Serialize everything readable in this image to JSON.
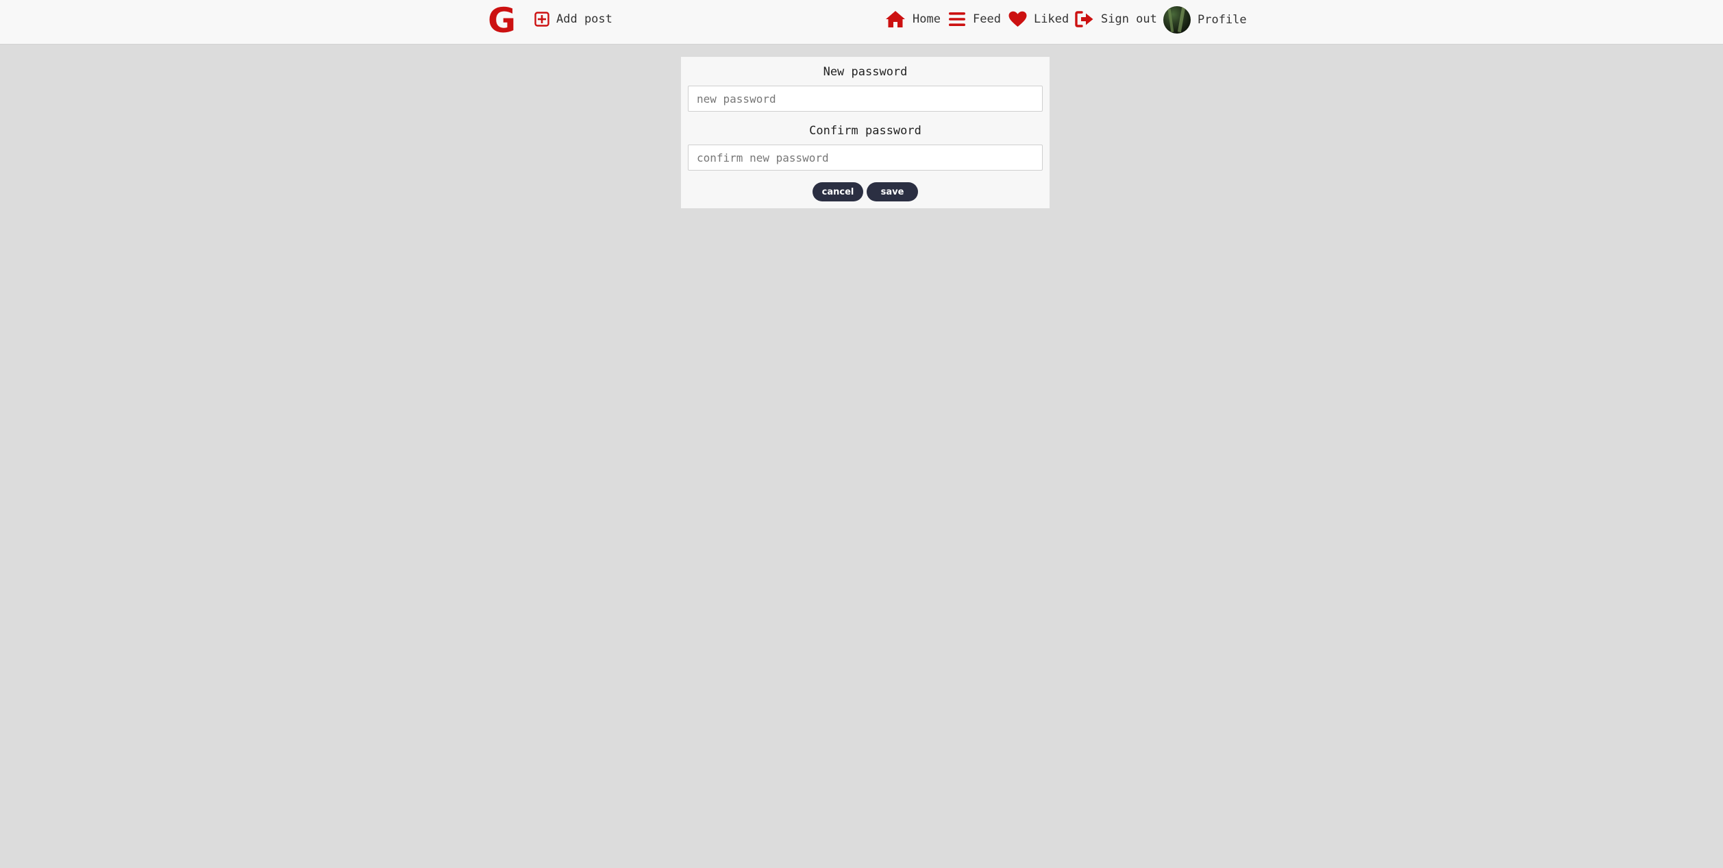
{
  "header": {
    "logo_text": "G",
    "add_post_label": "Add post",
    "nav": {
      "home": "Home",
      "feed": "Feed",
      "liked": "Liked",
      "sign_out": "Sign out",
      "profile": "Profile"
    },
    "icons": {
      "add_post": "plus-square-icon",
      "home": "home-icon",
      "feed": "menu-bars-icon",
      "liked": "heart-icon",
      "sign_out": "sign-out-icon"
    }
  },
  "form": {
    "new_password_label": "New password",
    "new_password_placeholder": "new password",
    "new_password_value": "",
    "confirm_password_label": "Confirm password",
    "confirm_password_placeholder": "confirm new password",
    "confirm_password_value": "",
    "cancel_label": "cancel",
    "save_label": "save"
  },
  "colors": {
    "accent_red": "#cc1111",
    "button_dark": "#2b2f42",
    "page_background": "#dcdcdc",
    "header_background": "#f8f8f8"
  }
}
